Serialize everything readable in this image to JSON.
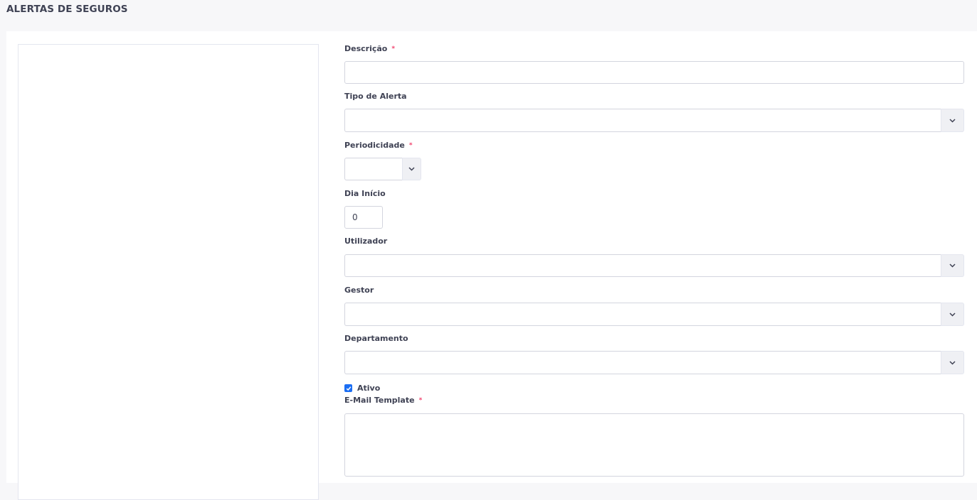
{
  "header": {
    "title": "ALERTAS DE SEGUROS"
  },
  "form": {
    "descricao": {
      "label": "Descrição",
      "required_mark": "*",
      "value": ""
    },
    "tipo_alerta": {
      "label": "Tipo de Alerta",
      "value": "",
      "icon": "chevron-down-icon"
    },
    "periodicidade": {
      "label": "Periodicidade",
      "required_mark": "*",
      "value": "",
      "icon": "chevron-down-icon"
    },
    "dia_inicio": {
      "label": "Dia Início",
      "value": "0"
    },
    "utilizador": {
      "label": "Utilizador",
      "value": "",
      "icon": "chevron-down-icon"
    },
    "gestor": {
      "label": "Gestor",
      "value": "",
      "icon": "chevron-down-icon"
    },
    "departamento": {
      "label": "Departamento",
      "value": "",
      "icon": "chevron-down-icon"
    },
    "ativo": {
      "label": "Ativo",
      "checked": true
    },
    "email_template": {
      "label": "E-Mail Template",
      "required_mark": "*",
      "value": ""
    }
  },
  "colors": {
    "accent": "#1b6ef3",
    "required": "#f1416c",
    "border": "#d3d5de",
    "page_bg": "#f7f7f9"
  }
}
